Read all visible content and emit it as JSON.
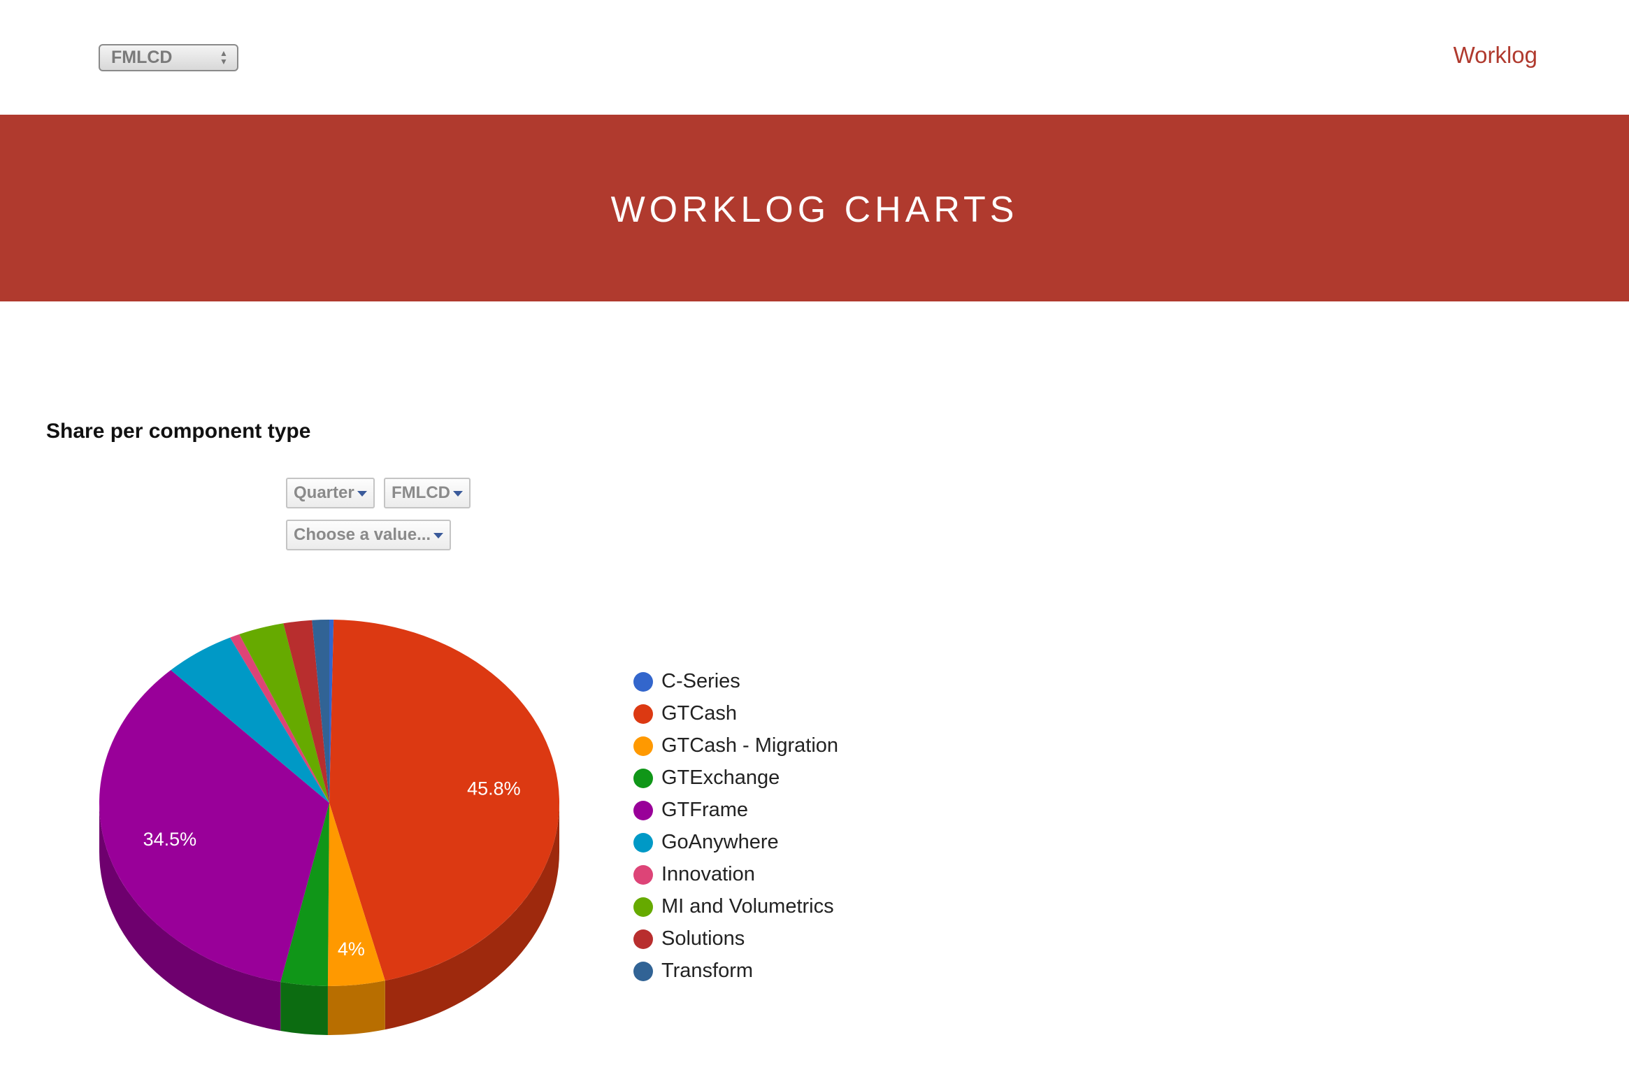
{
  "top_select": {
    "value": "FMLCD"
  },
  "nav": {
    "worklog_link": "Worklog"
  },
  "banner": {
    "title": "WORKLOG CHARTS"
  },
  "section": {
    "title": "Share per component type"
  },
  "filters": {
    "period": "Quarter",
    "team": "FMLCD",
    "value": "Choose a value..."
  },
  "chart_data": {
    "type": "pie",
    "style": "3d",
    "title": "",
    "legend_placement": "right",
    "slices": [
      {
        "name": "C-Series",
        "value": 0.3,
        "color": "#3366cc",
        "label": ""
      },
      {
        "name": "GTCash",
        "value": 45.8,
        "color": "#dc3912",
        "label": "45.8%"
      },
      {
        "name": "GTCash - Migration",
        "value": 4.0,
        "color": "#ff9900",
        "label": "4%"
      },
      {
        "name": "GTExchange",
        "value": 3.3,
        "color": "#109618",
        "label": ""
      },
      {
        "name": "GTFrame",
        "value": 34.5,
        "color": "#990099",
        "label": "34.5%"
      },
      {
        "name": "GoAnywhere",
        "value": 5.0,
        "color": "#0099c6",
        "label": ""
      },
      {
        "name": "Innovation",
        "value": 0.7,
        "color": "#dd4477",
        "label": ""
      },
      {
        "name": "MI and Volumetrics",
        "value": 3.2,
        "color": "#66aa00",
        "label": ""
      },
      {
        "name": "Solutions",
        "value": 2.0,
        "color": "#b82e2e",
        "label": ""
      },
      {
        "name": "Transform",
        "value": 1.2,
        "color": "#316395",
        "label": ""
      }
    ]
  }
}
